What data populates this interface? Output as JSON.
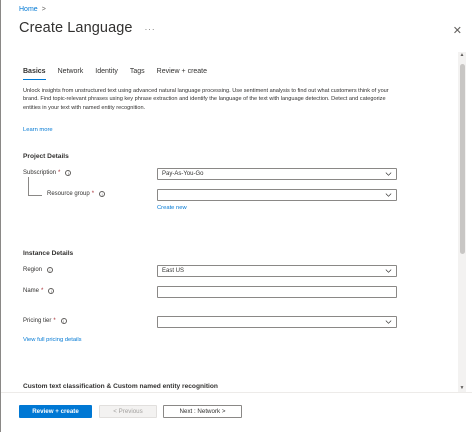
{
  "breadcrumb": {
    "home": "Home",
    "separator": ">"
  },
  "header": {
    "title": "Create Language",
    "more": "···",
    "close": "✕"
  },
  "tabs": [
    {
      "label": "Basics",
      "active": true
    },
    {
      "label": "Network",
      "active": false
    },
    {
      "label": "Identity",
      "active": false
    },
    {
      "label": "Tags",
      "active": false
    },
    {
      "label": "Review + create",
      "active": false
    }
  ],
  "intro": {
    "text": "Unlock insights from unstructured text using advanced natural language processing. Use sentiment analysis to find out what customers think of your brand. Find topic-relevant phrases using key phrase extraction and identify the language of the text with language detection. Detect and categorize entities in your text with named entity recognition.",
    "learn_more": "Learn more"
  },
  "project_details": {
    "heading": "Project Details",
    "subscription": {
      "label": "Subscription",
      "required": "*",
      "value": "Pay-As-You-Go"
    },
    "resource_group": {
      "label": "Resource group",
      "required": "*",
      "value": "",
      "create_new": "Create new"
    }
  },
  "instance_details": {
    "heading": "Instance Details",
    "region": {
      "label": "Region",
      "value": "East US"
    },
    "name": {
      "label": "Name",
      "required": "*",
      "value": ""
    },
    "pricing_tier": {
      "label": "Pricing tier",
      "required": "*",
      "value": "",
      "link": "View full pricing details"
    }
  },
  "custom_section": {
    "heading": "Custom text classification & Custom named entity recognition"
  },
  "footer": {
    "review_create": "Review + create",
    "previous": "< Previous",
    "next": "Next : Network >"
  },
  "colors": {
    "accent": "#0078d4",
    "required": "#a4262c",
    "text": "#323130",
    "border": "#8a8886"
  },
  "icons": {
    "info": "i",
    "chevron": "chevron-down-icon",
    "scroll_up": "▲",
    "scroll_down": "▼"
  }
}
